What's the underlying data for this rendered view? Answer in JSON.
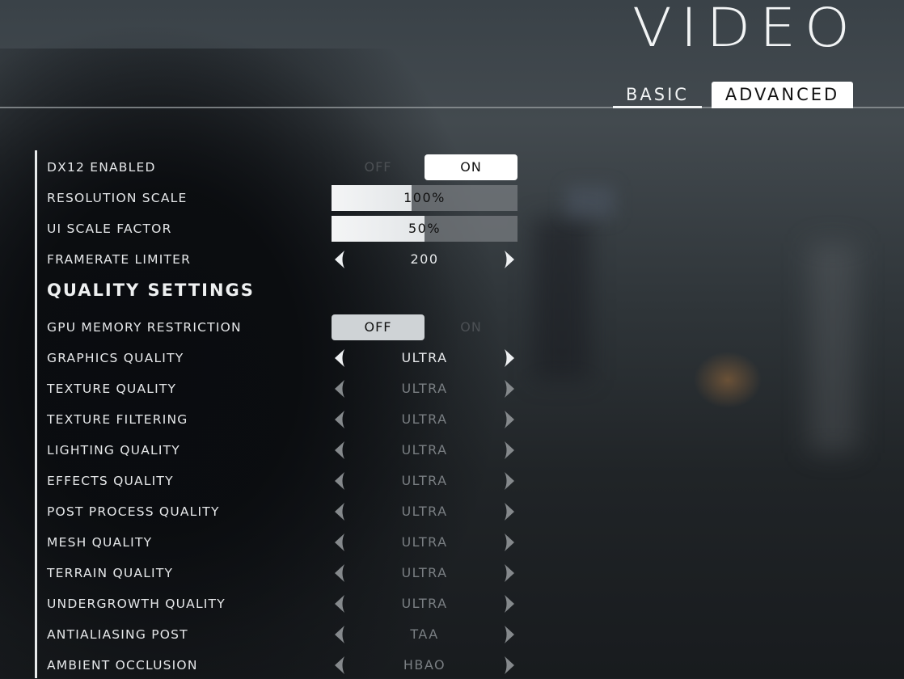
{
  "page": {
    "title": "VIDEO",
    "tabs": [
      {
        "label": "BASIC",
        "active": false
      },
      {
        "label": "ADVANCED",
        "active": true
      }
    ]
  },
  "settings": [
    {
      "label": "DX12 ENABLED",
      "type": "toggle",
      "options": [
        "OFF",
        "ON"
      ],
      "selected": "ON"
    },
    {
      "label": "RESOLUTION SCALE",
      "type": "slider",
      "value": "100%",
      "fill_fraction": 0.43
    },
    {
      "label": "UI SCALE FACTOR",
      "type": "slider",
      "value": "50%",
      "fill_fraction": 0.5
    },
    {
      "label": "FRAMERATE LIMITER",
      "type": "selector",
      "value": "200",
      "enabled": true
    }
  ],
  "section": {
    "title": "QUALITY SETTINGS"
  },
  "quality_settings": [
    {
      "label": "GPU MEMORY RESTRICTION",
      "type": "toggle",
      "options": [
        "OFF",
        "ON"
      ],
      "selected": "OFF"
    },
    {
      "label": "GRAPHICS QUALITY",
      "type": "selector",
      "value": "ULTRA",
      "enabled": true
    },
    {
      "label": "TEXTURE QUALITY",
      "type": "selector",
      "value": "ULTRA",
      "enabled": false
    },
    {
      "label": "TEXTURE FILTERING",
      "type": "selector",
      "value": "ULTRA",
      "enabled": false
    },
    {
      "label": "LIGHTING QUALITY",
      "type": "selector",
      "value": "ULTRA",
      "enabled": false
    },
    {
      "label": "EFFECTS QUALITY",
      "type": "selector",
      "value": "ULTRA",
      "enabled": false
    },
    {
      "label": "POST PROCESS QUALITY",
      "type": "selector",
      "value": "ULTRA",
      "enabled": false
    },
    {
      "label": "MESH QUALITY",
      "type": "selector",
      "value": "ULTRA",
      "enabled": false
    },
    {
      "label": "TERRAIN QUALITY",
      "type": "selector",
      "value": "ULTRA",
      "enabled": false
    },
    {
      "label": "UNDERGROWTH QUALITY",
      "type": "selector",
      "value": "ULTRA",
      "enabled": false
    },
    {
      "label": "ANTIALIASING POST",
      "type": "selector",
      "value": "TAA",
      "enabled": false
    },
    {
      "label": "AMBIENT OCCLUSION",
      "type": "selector",
      "value": "HBAO",
      "enabled": false
    }
  ],
  "icons": {
    "left": "chevron-left-icon",
    "right": "chevron-right-icon"
  }
}
